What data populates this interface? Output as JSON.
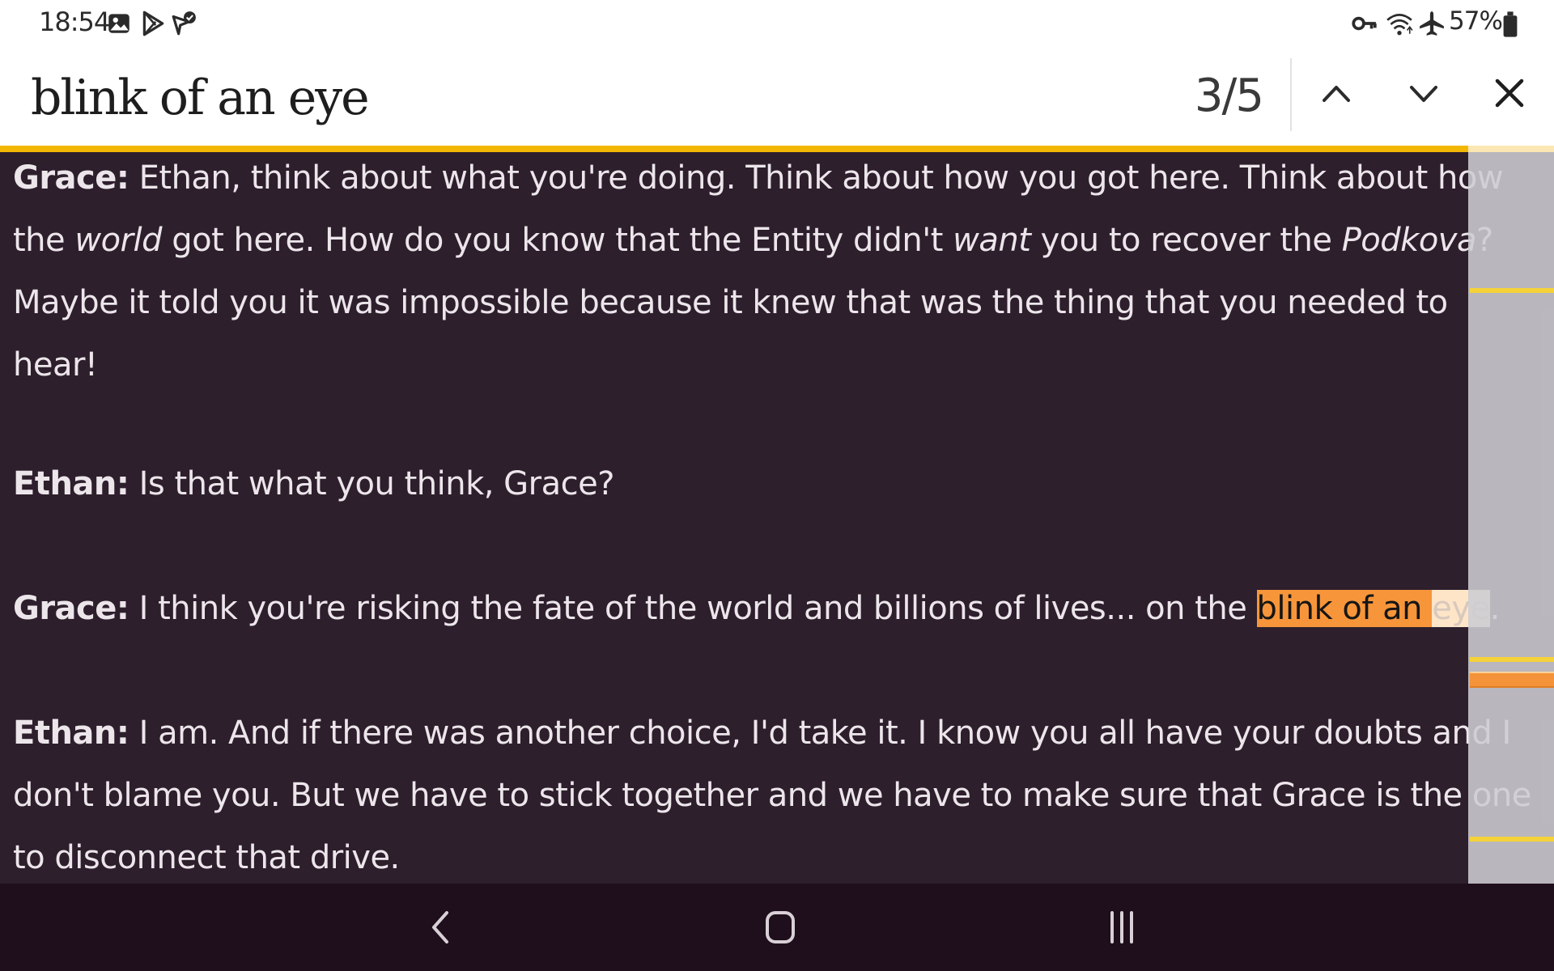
{
  "status_bar": {
    "time": "18:54",
    "left_icons": [
      "gallery-icon",
      "play-store-icon",
      "verified-app-icon"
    ],
    "right_icons": [
      "vpn-key-icon",
      "wifi-icon",
      "airplane-icon",
      "battery-icon"
    ],
    "battery": "57%"
  },
  "find": {
    "query": "blink of an eye",
    "count": "3/5",
    "prev_icon": "chevron-up-icon",
    "next_icon": "chevron-down-icon",
    "close_icon": "close-icon"
  },
  "content": {
    "paragraphs": [
      {
        "speaker": "Grace:",
        "parts": [
          " Ethan, think about what you're doing. Think about how you got here. Think about how the ",
          "world",
          " got here. How do you know that the Entity didn't ",
          "want",
          " you to recover the ",
          "Podkova",
          "? Maybe it told you it was impossible because it knew that was the thing that you needed to hear!"
        ]
      },
      {
        "speaker": "Ethan:",
        "text": " Is that what you think, Grace?"
      },
      {
        "speaker": "Grace:",
        "before": " I think you're risking the fate of the world and billions of lives... on the ",
        "match_a": "blink of an ",
        "match_b": "eye",
        "after": "."
      },
      {
        "speaker": "Ethan:",
        "text": " I am. And if there was another choice, I'd take it. I know you all have your doubts and I don't blame you. But we have to stick together and we have to make sure that Grace is the one to disconnect that drive."
      }
    ]
  },
  "scroll_markers": {
    "total": 5,
    "current_index": 3,
    "colors": {
      "match": "#f5d23a",
      "current": "#f4933a"
    }
  },
  "navigation": {
    "back_icon": "back-icon",
    "home_icon": "home-icon",
    "recents_icon": "recents-icon"
  },
  "colors": {
    "background": "#2e1f2d",
    "text": "#ece6eb",
    "highlight_current": "#f7953a",
    "find_progress": "#f2b705",
    "navbar": "#1f0e1c"
  }
}
